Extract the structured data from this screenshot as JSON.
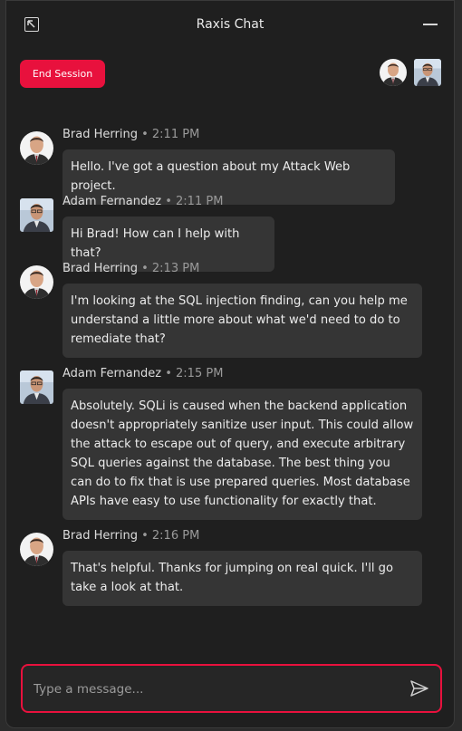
{
  "window": {
    "title": "Raxis Chat"
  },
  "session": {
    "end_label": "End Session"
  },
  "messages": [
    {
      "author": "Brad Herring",
      "time": "2:11 PM",
      "text": "Hello. I've got a question about my Attack Web project."
    },
    {
      "author": "Adam Fernandez",
      "time": "2:11 PM",
      "text": "Hi Brad! How can I help with that?"
    },
    {
      "author": "Brad Herring",
      "time": "2:13 PM",
      "text": "I'm looking at the SQL injection finding, can you help me understand a little more about what we'd need to do to remediate that?"
    },
    {
      "author": "Adam Fernandez",
      "time": "2:15 PM",
      "text": "Absolutely. SQLi is caused when the backend application doesn't appropriately sanitize user input. This could allow the attack to escape out of query, and execute arbitrary SQL queries against the database. The best thing you can do to fix that is use prepared queries. Most database APIs have easy to use functionality for exactly that."
    },
    {
      "author": "Brad Herring",
      "time": "2:16 PM",
      "text": "That's helpful. Thanks for jumping on real quick. I'll go take a look at that."
    }
  ],
  "meta_separator": "•",
  "composer": {
    "placeholder": "Type a message..."
  },
  "colors": {
    "accent": "#e8113d",
    "bubble": "#353535",
    "background": "#1f1f1f"
  }
}
